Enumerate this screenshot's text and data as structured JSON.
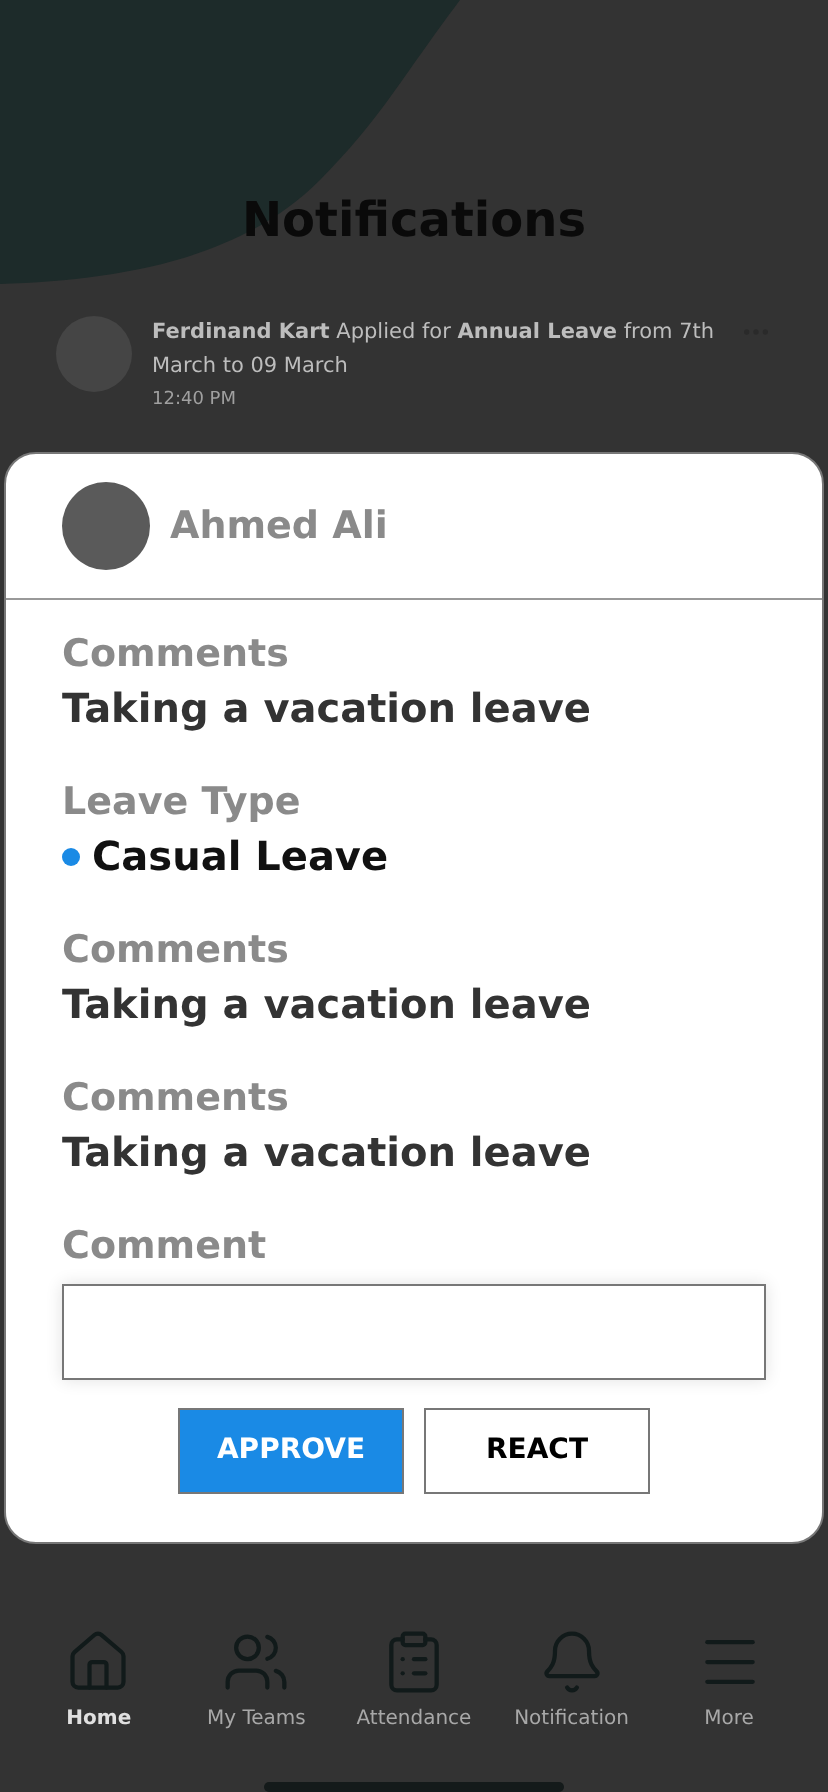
{
  "page": {
    "title": "Notifications"
  },
  "notification": {
    "text": "**Ferdinand Kart** Applied for **Annual Leave** from 7th March to 09 March",
    "time": "12:40 PM"
  },
  "dialog": {
    "name": "Ahmed Ali",
    "fields": [
      {
        "kind": "text",
        "label": "Comments",
        "value": "Taking a vacation leave"
      },
      {
        "kind": "status",
        "label": "Leave Type",
        "value": "Casual Leave"
      },
      {
        "kind": "text",
        "label": "Comments",
        "value": "Taking a vacation leave"
      },
      {
        "kind": "text",
        "label": "Comments",
        "value": "Taking a vacation leave"
      }
    ],
    "comment_label": "Comment",
    "buttons": [
      {
        "label": "APPROVE",
        "kind": "primary"
      },
      {
        "label": "REACT",
        "kind": "secondary"
      }
    ]
  },
  "nav": [
    {
      "label": "Home",
      "selected": true
    },
    {
      "label": "My Teams",
      "selected": false
    },
    {
      "label": "Attendance",
      "selected": false
    },
    {
      "label": "Notification",
      "selected": false
    },
    {
      "label": "More",
      "selected": false
    }
  ]
}
